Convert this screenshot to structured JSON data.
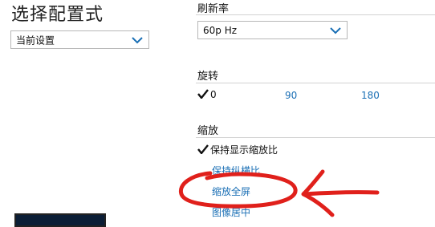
{
  "page_title": "选择配置式",
  "profile_select": {
    "value": "当前设置",
    "icon": "chevron-down-icon"
  },
  "refresh": {
    "label": "刷新率",
    "select": {
      "value": "60p Hz",
      "icon": "chevron-down-icon"
    }
  },
  "rotation": {
    "label": "旋转",
    "options": [
      {
        "label": "0",
        "selected": true
      },
      {
        "label": "90",
        "selected": false
      },
      {
        "label": "180",
        "selected": false
      }
    ]
  },
  "scaling": {
    "label": "缩放",
    "options": [
      {
        "label": "保持显示缩放比",
        "selected": true
      },
      {
        "label": "保持纵横比",
        "selected": false
      },
      {
        "label": "缩放全屏",
        "selected": false,
        "annotated": true
      },
      {
        "label": "图像居中",
        "selected": false
      }
    ]
  },
  "colors": {
    "link": "#1a6fb5",
    "accent_chevron": "#1a6fb5",
    "annotation": "#e0201b",
    "monitor": "#0b1e36"
  },
  "annotation": {
    "shape": "hand-drawn circle with arrow",
    "target": "缩放全屏"
  }
}
